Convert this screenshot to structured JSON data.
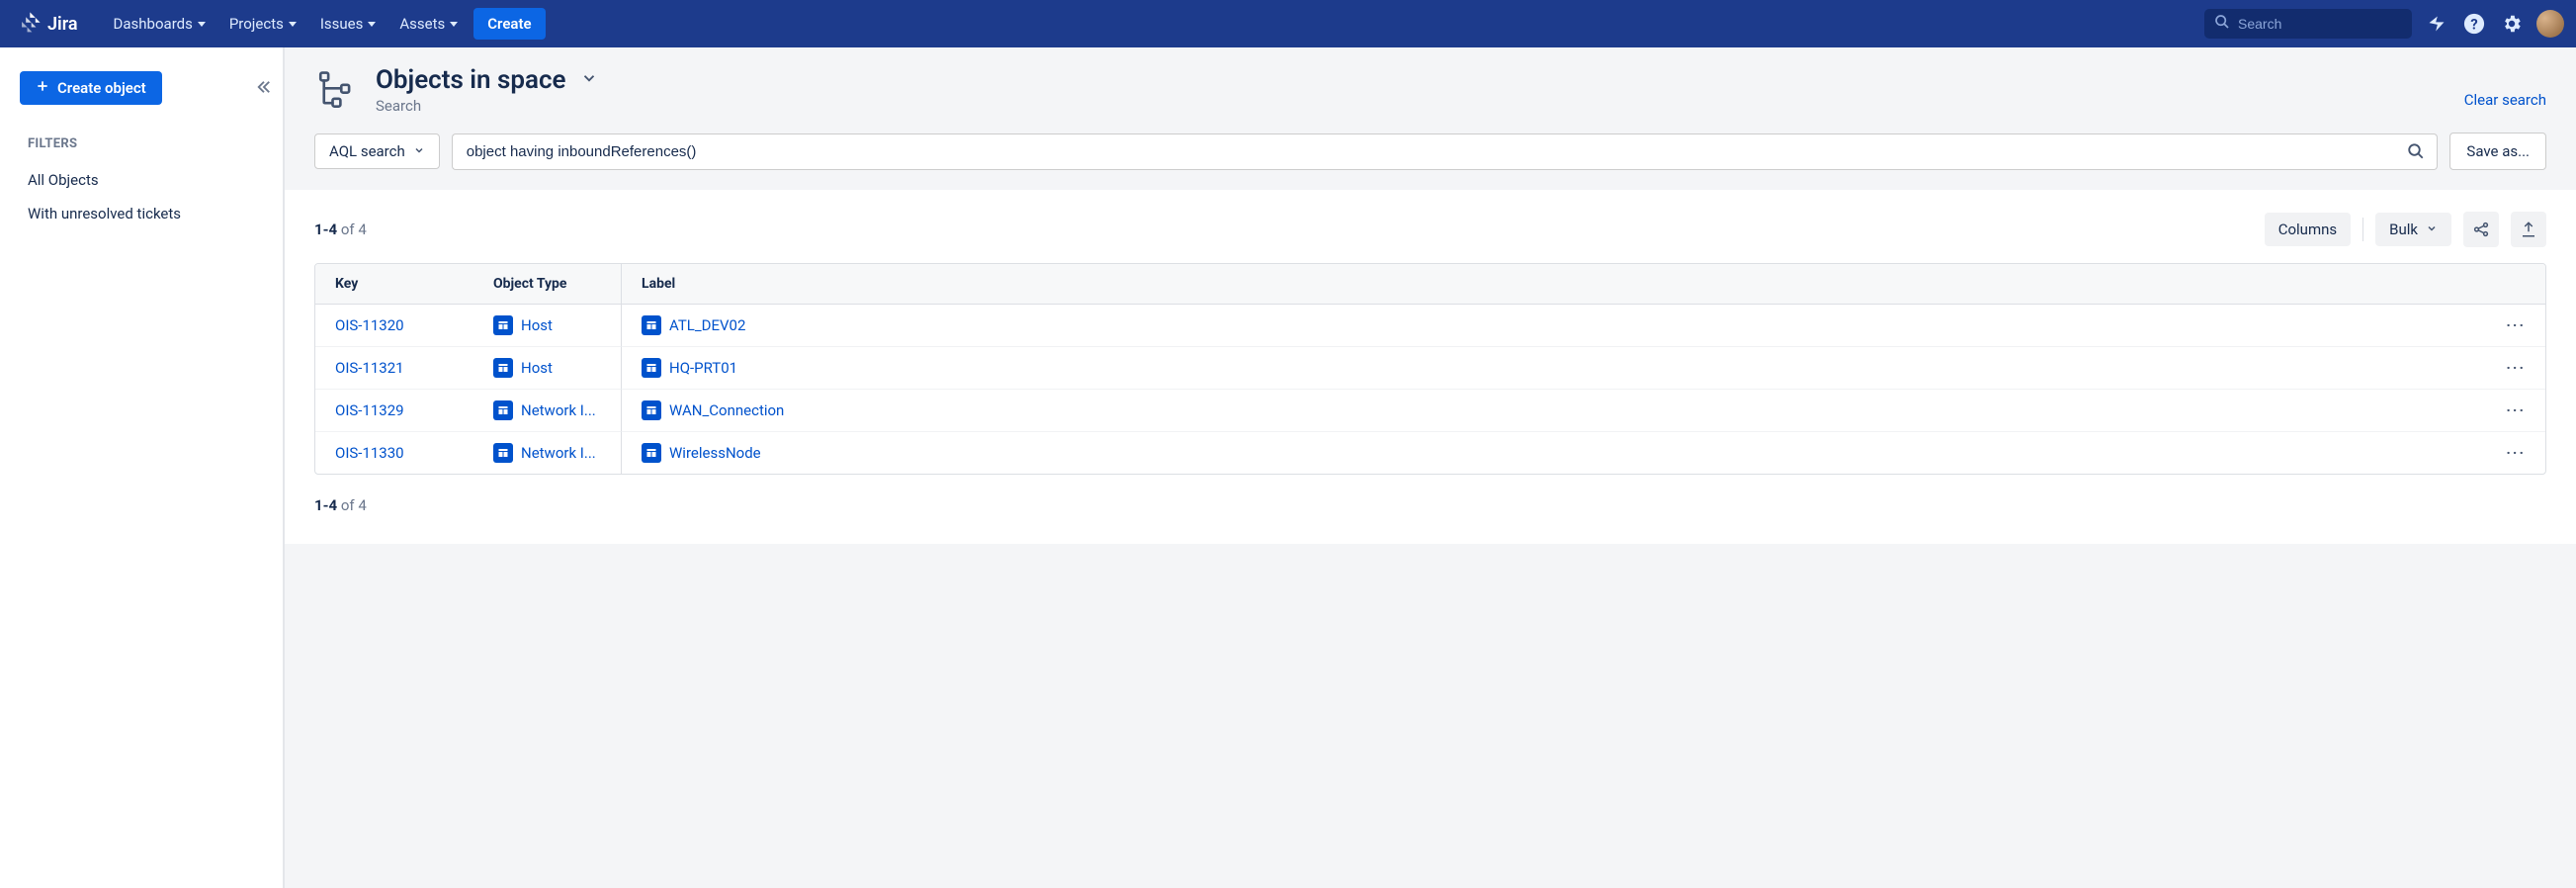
{
  "topnav": {
    "logo_text": "Jira",
    "items": [
      {
        "label": "Dashboards"
      },
      {
        "label": "Projects"
      },
      {
        "label": "Issues"
      },
      {
        "label": "Assets"
      }
    ],
    "create_label": "Create",
    "search_placeholder": "Search"
  },
  "sidebar": {
    "create_object_label": "Create object",
    "filters_header": "FILTERS",
    "filters": [
      {
        "label": "All Objects"
      },
      {
        "label": "With unresolved tickets"
      }
    ]
  },
  "header": {
    "title": "Objects in space",
    "subtitle": "Search",
    "clear_label": "Clear search"
  },
  "searchbar": {
    "mode_label": "AQL search",
    "query_value": "object having inboundReferences()",
    "save_as_label": "Save as..."
  },
  "toolbar": {
    "count_bold": "1-4",
    "count_rest": " of 4",
    "columns_label": "Columns",
    "bulk_label": "Bulk"
  },
  "table": {
    "headers": {
      "key": "Key",
      "type": "Object Type",
      "label": "Label"
    },
    "rows": [
      {
        "key": "OIS-11320",
        "type": "Host",
        "type_trunc": "Host",
        "label": "ATL_DEV02"
      },
      {
        "key": "OIS-11321",
        "type": "Host",
        "type_trunc": "Host",
        "label": "HQ-PRT01"
      },
      {
        "key": "OIS-11329",
        "type": "Network I…",
        "type_trunc": "Network I...",
        "label": "WAN_Connection"
      },
      {
        "key": "OIS-11330",
        "type": "Network I…",
        "type_trunc": "Network I...",
        "label": "WirelessNode"
      }
    ]
  },
  "footer": {
    "count_bold": "1-4",
    "count_rest": " of 4"
  }
}
